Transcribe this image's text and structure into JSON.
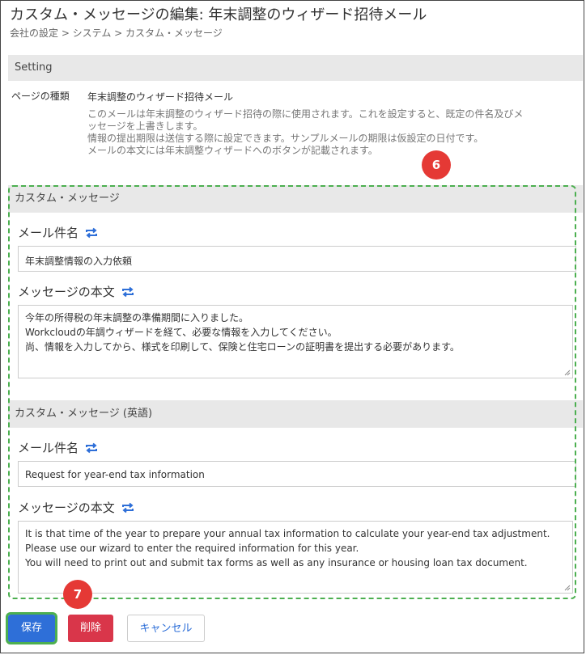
{
  "header": {
    "title": "カスタム・メッセージの編集: 年末調整のウィザード招待メール",
    "breadcrumb": "会社の設定 > システム > カスタム・メッセージ"
  },
  "setting": {
    "heading": "Setting",
    "page_type_label": "ページの種類",
    "page_type_value": "年末調整のウィザード招待メール",
    "description": [
      "このメールは年末調整のウィザード招待の際に使用されます。これを設定すると、既定の件名及びメ",
      "ッセージを上書きします。",
      "情報の提出期限は送信する際に設定できます。サンプルメールの期限は仮設定の日付です。",
      "メールの本文には年末調整ウィザードへのボタンが記載されます。"
    ]
  },
  "custom_message": {
    "heading": "カスタム・メッセージ",
    "subject_label": "メール件名",
    "subject_value": "年末調整情報の入力依頼",
    "body_label": "メッセージの本文",
    "body_lines": [
      "今年の所得税の年末調整の準備期間に入りました。",
      "Workcloudの年調ウィザードを経て、必要な情報を入力してください。",
      "尚、情報を入力してから、様式を印刷して、保険と住宅ローンの証明書を提出する必要があります。"
    ]
  },
  "custom_message_en": {
    "heading": "カスタム・メッセージ (英語)",
    "subject_label": "メール件名",
    "subject_value": "Request for year-end tax information",
    "body_label": "メッセージの本文",
    "body_lines": [
      "It is that time of the year to prepare your annual tax information to calculate your year-end tax adjustment.",
      "Please use our wizard to enter the required information for this year.",
      "You will need to print out and submit tax forms as well as any insurance or housing loan tax document."
    ]
  },
  "actions": {
    "save": "保存",
    "delete": "削除",
    "cancel": "キャンセル"
  },
  "annotations": {
    "badge_6": "6",
    "badge_7": "7"
  },
  "colors": {
    "accent_blue": "#2e6fd8",
    "danger_red": "#d9364a",
    "annotation_red": "#e53935",
    "annotation_green": "#4caf50"
  },
  "icons": {
    "sync": "sync-icon"
  }
}
